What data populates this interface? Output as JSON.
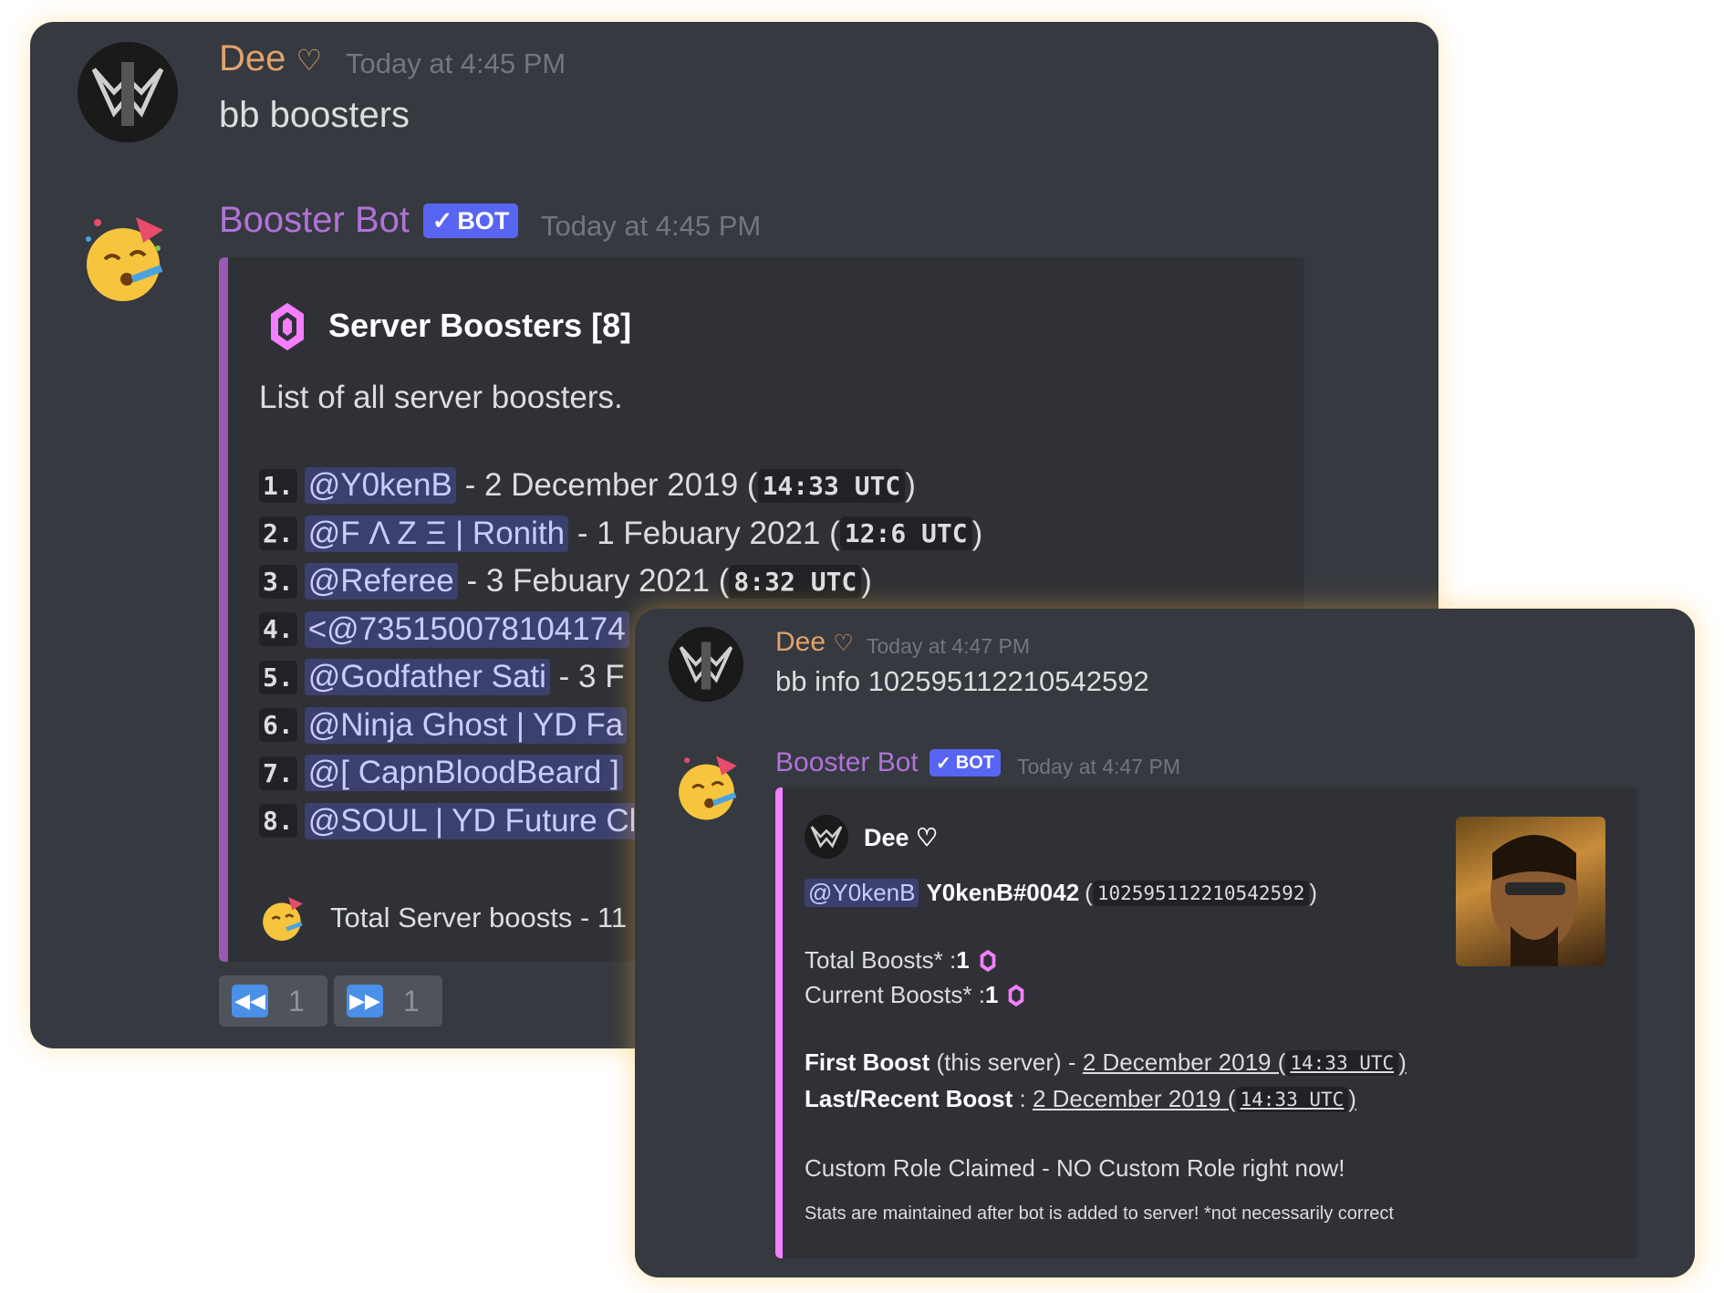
{
  "panel1": {
    "msg1": {
      "username": "Dee",
      "heart": "♡",
      "timestamp": "Today at 4:45 PM",
      "text": "bb boosters"
    },
    "msg2": {
      "username": "Booster Bot",
      "bot_tag": "BOT",
      "timestamp": "Today at 4:45 PM",
      "embed": {
        "title": "Server Boosters [8]",
        "description": "List of all server boosters.",
        "boosters": [
          {
            "num": "1.",
            "mention": "@Y0kenB",
            "rest": " - 2 December 2019 (",
            "time": "14:33 UTC",
            "close": ")"
          },
          {
            "num": "2.",
            "mention": "@F Λ Z Ξ | Ronith",
            "rest": " - 1 Febuary 2021 (",
            "time": "12:6 UTC",
            "close": ")"
          },
          {
            "num": "3.",
            "mention": "@Referee",
            "rest": " - 3 Febuary 2021 (",
            "time": "8:32 UTC",
            "close": ")"
          },
          {
            "num": "4.",
            "mention": "<@735150078104174",
            "rest": "",
            "time": "",
            "close": ""
          },
          {
            "num": "5.",
            "mention": "@Godfather Sati",
            "rest": " - 3 F",
            "time": "",
            "close": ""
          },
          {
            "num": "6.",
            "mention": "@Ninja Ghost | YD Fa",
            "rest": "",
            "time": "",
            "close": ""
          },
          {
            "num": "7.",
            "mention": "@[ CapnBloodBeard ]",
            "rest": "",
            "time": "",
            "close": ""
          },
          {
            "num": "8.",
            "mention": "@SOUL | YD Future Cl",
            "rest": "",
            "time": "",
            "close": ""
          }
        ],
        "footer": "Total Server boosts - 11 •"
      },
      "nav": [
        {
          "icon": "rewind-icon",
          "count": "1"
        },
        {
          "icon": "fast-forward-icon",
          "count": "1"
        }
      ]
    }
  },
  "panel2": {
    "msg1": {
      "username": "Dee",
      "heart": "♡",
      "timestamp": "Today at 4:47 PM",
      "text": "bb info 102595112210542592"
    },
    "msg2": {
      "username": "Booster Bot",
      "bot_tag": "BOT",
      "timestamp": "Today at 4:47 PM",
      "embed": {
        "author": "Dee ♡",
        "mention": "@Y0kenB",
        "tag": "Y0kenB#0042",
        "user_id": "102595112210542592",
        "total_boosts_label": "Total Boosts* : ",
        "total_boosts_value": "1",
        "current_boosts_label": "Current Boosts* : ",
        "current_boosts_value": "1",
        "first_boost_label": "First Boost",
        "first_boost_scope": " (this server) - ",
        "first_boost_date": "2 December 2019 (",
        "first_boost_time": "14:33 UTC",
        "last_boost_label": "Last/Recent Boost",
        "last_boost_sep": " : ",
        "last_boost_date": "2 December 2019 (",
        "last_boost_time": "14:33 UTC",
        "custom_role": "Custom Role Claimed - NO Custom Role right now!",
        "footer": "Stats are maintained after bot is added to server! *not necessarily correct"
      }
    }
  },
  "colors": {
    "background": "#36393f",
    "embed_bg": "#2f3136",
    "embed_bar_list": "#9b59b6",
    "embed_bar_info": "#f47fff",
    "dee_name": "#e0a36c",
    "bot_name": "#b073d9",
    "bot_tag": "#5865f2",
    "nav_icon": "#4a8fe8"
  }
}
